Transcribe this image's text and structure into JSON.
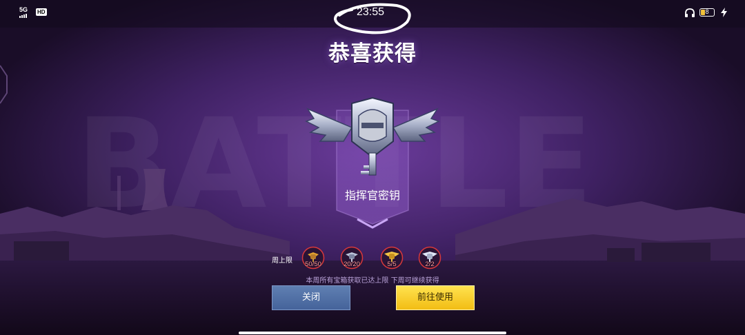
{
  "status_bar": {
    "network": "5G",
    "hd_badge": "HD",
    "time": "23:55",
    "battery_level": "8",
    "battery_color": "#f2c23b",
    "icons": [
      "signal-icon",
      "headphones-icon",
      "battery-icon",
      "charging-bolt-icon"
    ]
  },
  "reward": {
    "title": "恭喜获得",
    "item_name": "指挥官密钥",
    "item_icon": "commander-key-emblem"
  },
  "weekly_limits": {
    "label": "周上限",
    "items": [
      {
        "icon": "gold-key-icon",
        "count": "50/50"
      },
      {
        "icon": "silver-key-icon",
        "count": "20/20"
      },
      {
        "icon": "gold-winged-key-icon",
        "count": "5/5"
      },
      {
        "icon": "diamond-key-icon",
        "count": "2/2"
      }
    ],
    "note": "本周所有宝箱获取已达上限 下周可继续获得"
  },
  "buttons": {
    "close": "关闭",
    "use": "前往使用"
  },
  "colors": {
    "accent_gold": "#f2bd14",
    "button_blue": "#45639a",
    "limit_ring": "#d8383b",
    "background": "#1c0f2c"
  }
}
